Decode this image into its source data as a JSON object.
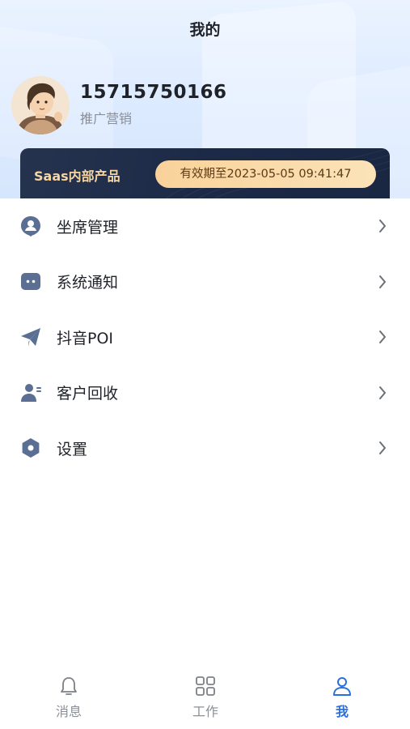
{
  "header": {
    "title": "我的"
  },
  "profile": {
    "username": "15715750166",
    "role": "推广营销"
  },
  "vip": {
    "name": "Saas内部产品",
    "expire": "有效期至2023-05-05 09:41:47"
  },
  "menu": {
    "items": [
      {
        "label": "坐席管理",
        "icon": "user-circle-icon"
      },
      {
        "label": "系统通知",
        "icon": "chat-bubble-icon"
      },
      {
        "label": "抖音POI",
        "icon": "paper-plane-icon"
      },
      {
        "label": "客户回收",
        "icon": "user-recycle-icon"
      },
      {
        "label": "设置",
        "icon": "gear-icon"
      }
    ]
  },
  "tabbar": {
    "tabs": [
      {
        "label": "消息",
        "icon": "bell-icon",
        "active": false
      },
      {
        "label": "工作",
        "icon": "grid-icon",
        "active": false
      },
      {
        "label": "我",
        "icon": "person-icon",
        "active": true
      }
    ]
  },
  "colors": {
    "accent": "#2a6fe0",
    "menu_icon": "#5b6f94",
    "vip_gold": "#f9d29a",
    "vip_bg": "#1c2a47"
  }
}
